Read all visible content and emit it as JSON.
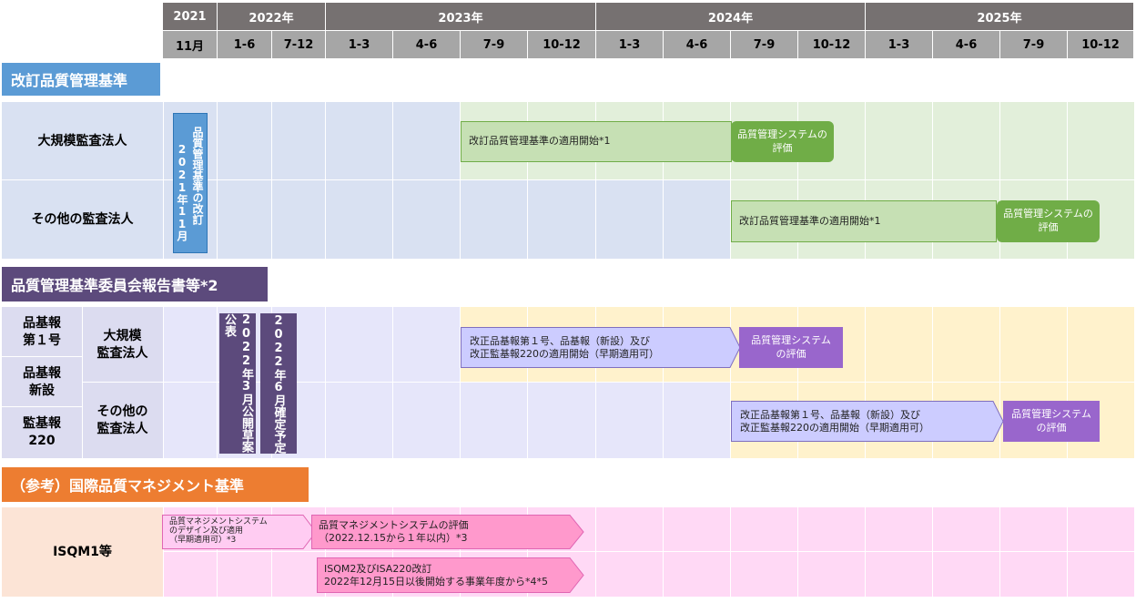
{
  "years": [
    "2021",
    "2022年",
    "2023年",
    "2024年",
    "2025年"
  ],
  "periods": [
    "11月",
    "1-6",
    "7-12",
    "1-3",
    "4-6",
    "7-9",
    "10-12",
    "1-3",
    "4-6",
    "7-9",
    "10-12",
    "1-3",
    "4-6",
    "7-9",
    "10-12"
  ],
  "sections": {
    "s1": "改訂品質管理基準",
    "s2": "品質管理基準委員会報告書等*2",
    "s3": "（参考）国際品質マネジメント基準"
  },
  "rows": {
    "large": "大規模監査法人",
    "other": "その他の監査法人",
    "std1": "品基報\n第１号",
    "std_new": "品基報\n新設",
    "audit220": "監基報\n220",
    "large2": "大規模\n監査法人",
    "other2": "その他の\n監査法人",
    "isqm": "ISQM1等"
  },
  "bars": {
    "revision_2021": "品質管理基準の改訂",
    "revision_2021_date": "2021年11月",
    "apply_large": "改訂品質管理基準の適用開始*1",
    "eval": "品質管理システムの評価",
    "apply_other": "改訂品質管理基準の適用開始*1",
    "draft": "2022年3月公開草案公表",
    "final": "2022年6月確定予定",
    "apply2_large": "改正品基報第１号、品基報（新設）及び\n改正監基報220の適用開始（早期適用可）",
    "eval2": "品質管理システムの評価",
    "apply2_other": "改正品基報第１号、品基報（新設）及び\n改正監基報220の適用開始（早期適用可）",
    "isqm_design": "品質マネジメントシステム\nのデザイン及び適用\n（早期適用可）*3",
    "isqm_eval": "品質マネジメントシステムの評価\n（2022.12.15から１年以内）*3",
    "isqm2": "ISQM2及びISA220改訂\n2022年12月15日以後開始する事業年度から*4*5"
  },
  "colors": {
    "header": "#767171",
    "sec1": "#5b9bd5",
    "sec2": "#5c4a7c",
    "sec3": "#ed7d31",
    "green": "#70ad47",
    "purple": "#9966cc",
    "pink": "#ff99cc"
  }
}
